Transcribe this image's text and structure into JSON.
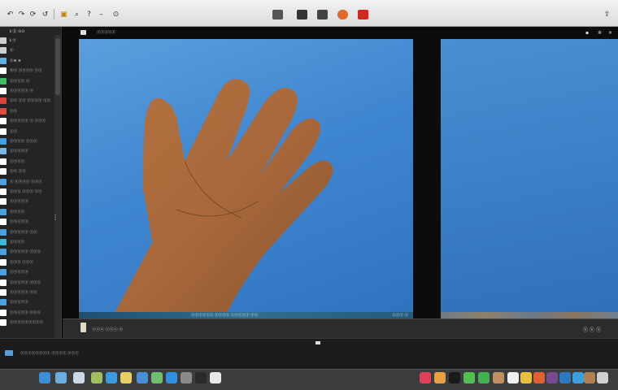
{
  "toolbar": {
    "buttons": [
      "undo-icon",
      "redo-icon",
      "rotate-icon",
      "history-icon",
      "help-icon",
      "minus-icon"
    ],
    "tools": [
      "crop-tool",
      "enhance-tool",
      "adjust-tool",
      "retouch-tool",
      "redeye-tool"
    ]
  },
  "sidebar": {
    "title": "ℹ  Ⓢ ⊙⊙",
    "items": [
      {
        "label": "ℹ Ⓢ",
        "color": "#cfcfcf"
      },
      {
        "label": "Ⓢ",
        "color": "#cfcfcf"
      },
      {
        "label": "Ⓢ⊕ ⊕",
        "color": "#5fb0e8"
      },
      {
        "label": "Ⓢⓢ ⓢⓢⓢⓢ ⓢⓢ",
        "color": "#ffffff"
      },
      {
        "label": "ⓢⓢⓢⓢ ⓢ",
        "color": "#3fbf63"
      },
      {
        "label": "ⓢⓢⓢⓢⓢ ⓢ",
        "color": "#ffffff"
      },
      {
        "label": "ⓢⓢ ⓢⓢ ⓢⓢⓢⓢ ⓢⓢ",
        "color": "#e0403a"
      },
      {
        "label": "ⓢⓢ",
        "color": "#e04a40"
      },
      {
        "label": "ⓢⓢⓢⓢⓢ ⓢ ⓢⓢⓢ",
        "color": "#ffffff"
      },
      {
        "label": "ⓢⓢ",
        "color": "#ffffff"
      },
      {
        "label": "ⓢⓢⓢⓢ ⓢⓢⓢ",
        "color": "#46a0e0"
      },
      {
        "label": "ⓢⓢⓢⓢⓢ",
        "color": "#7db9e8"
      },
      {
        "label": "ⓢⓢⓢⓢ",
        "color": "#ffffff"
      },
      {
        "label": "ⓢⓢ ⓢⓢ",
        "color": "#ffffff"
      },
      {
        "label": "ⓢ ⓢⓢⓢⓢ ⓢⓢⓢ",
        "color": "#4aa3e0"
      },
      {
        "label": "ⓢⓢⓢ ⓢⓢⓢ ⓢⓢ",
        "color": "#ffffff"
      },
      {
        "label": "ⓢⓢⓢⓢⓢ",
        "color": "#ffffff"
      },
      {
        "label": "ⓢⓢⓢⓢ",
        "color": "#4aa3e0"
      },
      {
        "label": "ⓢⓢⓢⓢⓢ",
        "color": "#ffffff"
      },
      {
        "label": "ⓢⓢⓢⓢⓢ ⓢⓢ",
        "color": "#4aa3e0"
      },
      {
        "label": "ⓢⓢⓢⓢ",
        "color": "#3bb8d8"
      },
      {
        "label": "ⓢⓢⓢⓢⓢ ⓢⓢⓢ",
        "color": "#4aa3e0"
      },
      {
        "label": "ⓢⓢⓢ ⓢⓢⓢ",
        "color": "#ffffff"
      },
      {
        "label": "ⓢⓢⓢⓢⓢ",
        "color": "#4aa3e0"
      },
      {
        "label": "ⓢⓢⓢⓢⓢ ⓢⓢⓢ",
        "color": "#ffffff"
      },
      {
        "label": "ⓢⓢⓢⓢⓢ ⓢⓢ",
        "color": "#ffffff"
      },
      {
        "label": "ⓢⓢⓢⓢⓢ",
        "color": "#4aa3e0"
      },
      {
        "label": "ⓢⓢⓢⓢⓢ ⓢⓢⓢ",
        "color": "#ffffff"
      },
      {
        "label": "ⓢⓢⓢⓢⓢⓢⓢⓢⓢ",
        "color": "#ffffff"
      }
    ]
  },
  "main": {
    "title": "ⓢⓢⓢⓢⓢ",
    "photo_caption": "ⓢⓢⓢⓢⓢⓢ ⓢⓢⓢⓢ ⓢⓢⓢⓢⓢ ⓢⓢ",
    "photo_caption_right": "ⓢⓢⓢ ⓢ",
    "strip_label": "ⓢⓢⓢ ⓢⓢⓢ  ⓢ",
    "strip_right": "ⓢ  ⓢ  ⓢ"
  },
  "filmstrip": {
    "label": "ⓢⓢⓢⓢⓢⓢⓢⓢ ⓢⓢⓢⓢ ⓢⓢⓢ"
  },
  "dock": {
    "items": [
      {
        "name": "finder-icon",
        "color": "#3a8fd8"
      },
      {
        "name": "launchpad-icon",
        "color": "#6aaee0"
      },
      {
        "name": "preview-icon",
        "color": "#c9d7e6"
      },
      {
        "name": "photos-icon",
        "color": "#a0c060"
      },
      {
        "name": "safari-icon",
        "color": "#3a9be0"
      },
      {
        "name": "notes-icon",
        "color": "#e8d060"
      },
      {
        "name": "mail-icon",
        "color": "#4a90d8"
      },
      {
        "name": "maps-icon",
        "color": "#6fbf6f"
      },
      {
        "name": "app-store-icon",
        "color": "#2f8fe0"
      },
      {
        "name": "settings-icon",
        "color": "#8a8a8a"
      },
      {
        "name": "terminal-icon",
        "color": "#2a2a2a"
      },
      {
        "name": "calendar-icon",
        "color": "#e8e8e8"
      },
      {
        "name": "music-icon",
        "color": "#e0405a"
      },
      {
        "name": "books-icon",
        "color": "#e8a040"
      },
      {
        "name": "tv-icon",
        "color": "#1a1a1a"
      },
      {
        "name": "messages-icon",
        "color": "#50c050"
      },
      {
        "name": "facetime-icon",
        "color": "#40b050"
      },
      {
        "name": "contacts-icon",
        "color": "#c09060"
      },
      {
        "name": "reminders-icon",
        "color": "#f0f0f0"
      },
      {
        "name": "chrome-icon",
        "color": "#e8c040"
      },
      {
        "name": "firefox-icon",
        "color": "#e06030"
      },
      {
        "name": "slack-icon",
        "color": "#7a4a90"
      },
      {
        "name": "vscode-icon",
        "color": "#2a7ac0"
      },
      {
        "name": "files-icon",
        "color": "#3aa0e0"
      },
      {
        "name": "archive-icon",
        "color": "#b08050"
      },
      {
        "name": "trash-icon",
        "color": "#d0d0d0"
      }
    ]
  }
}
